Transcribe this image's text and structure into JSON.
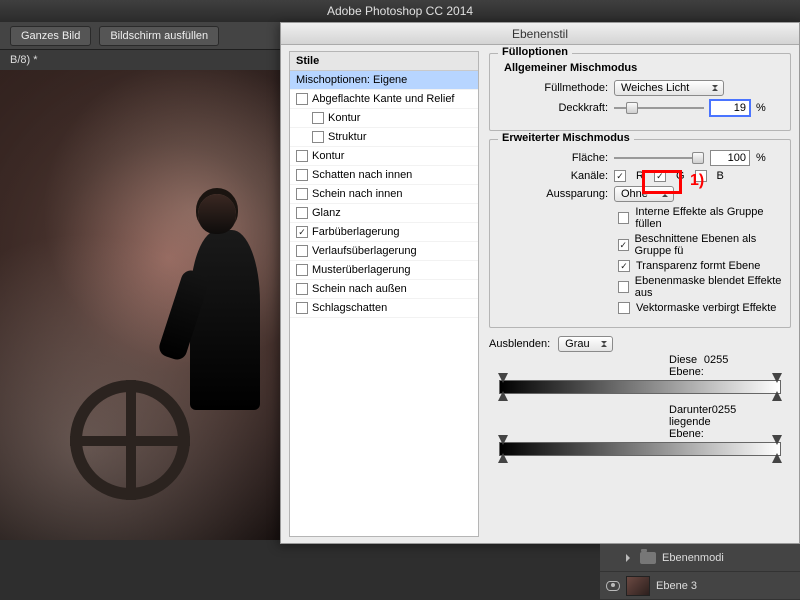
{
  "app_title": "Adobe Photoshop CC 2014",
  "toolbar": {
    "btn_fit": "Ganzes Bild",
    "btn_fill": "Bildschirm ausfüllen"
  },
  "tab": "B/8) *",
  "dialog": {
    "title": "Ebenenstil",
    "styles_header": "Stile",
    "styles": [
      {
        "label": "Mischoptionen: Eigene",
        "sel": true,
        "chk": null
      },
      {
        "label": "Abgeflachte Kante und Relief",
        "chk": false
      },
      {
        "label": "Kontur",
        "chk": false,
        "sub": true
      },
      {
        "label": "Struktur",
        "chk": false,
        "sub": true
      },
      {
        "label": "Kontur",
        "chk": false
      },
      {
        "label": "Schatten nach innen",
        "chk": false
      },
      {
        "label": "Schein nach innen",
        "chk": false
      },
      {
        "label": "Glanz",
        "chk": false
      },
      {
        "label": "Farbüberlagerung",
        "chk": true
      },
      {
        "label": "Verlaufsüberlagerung",
        "chk": false
      },
      {
        "label": "Musterüberlagerung",
        "chk": false
      },
      {
        "label": "Schein nach außen",
        "chk": false
      },
      {
        "label": "Schlagschatten",
        "chk": false
      }
    ],
    "fill_legend": "Fülloptionen",
    "gen_blend": "Allgemeiner Mischmodus",
    "fill_method_lab": "Füllmethode:",
    "fill_method_val": "Weiches Licht",
    "opacity_lab": "Deckkraft:",
    "opacity_val": "19",
    "pct": "%",
    "adv_blend": "Erweiterter Mischmodus",
    "fill_lab": "Fläche:",
    "fill_val": "100",
    "channels_lab": "Kanäle:",
    "ch_R": "R",
    "ch_G": "G",
    "ch_B": "B",
    "knockout_lab": "Aussparung:",
    "knockout_val": "Ohne",
    "opt1": "Interne Effekte als Gruppe füllen",
    "opt2": "Beschnittene Ebenen als Gruppe fü",
    "opt3": "Transparenz formt Ebene",
    "opt4": "Ebenenmaske blendet Effekte aus",
    "opt5": "Vektormaske verbirgt Effekte",
    "blendif_lab": "Ausblenden:",
    "blendif_val": "Grau",
    "this_layer": "Diese Ebene:",
    "under_layer": "Darunter liegende Ebene:",
    "v0": "0",
    "v255": "255",
    "annot": "1)"
  },
  "layers": {
    "group": "Ebenenmodi",
    "layer": "Ebene 3"
  }
}
